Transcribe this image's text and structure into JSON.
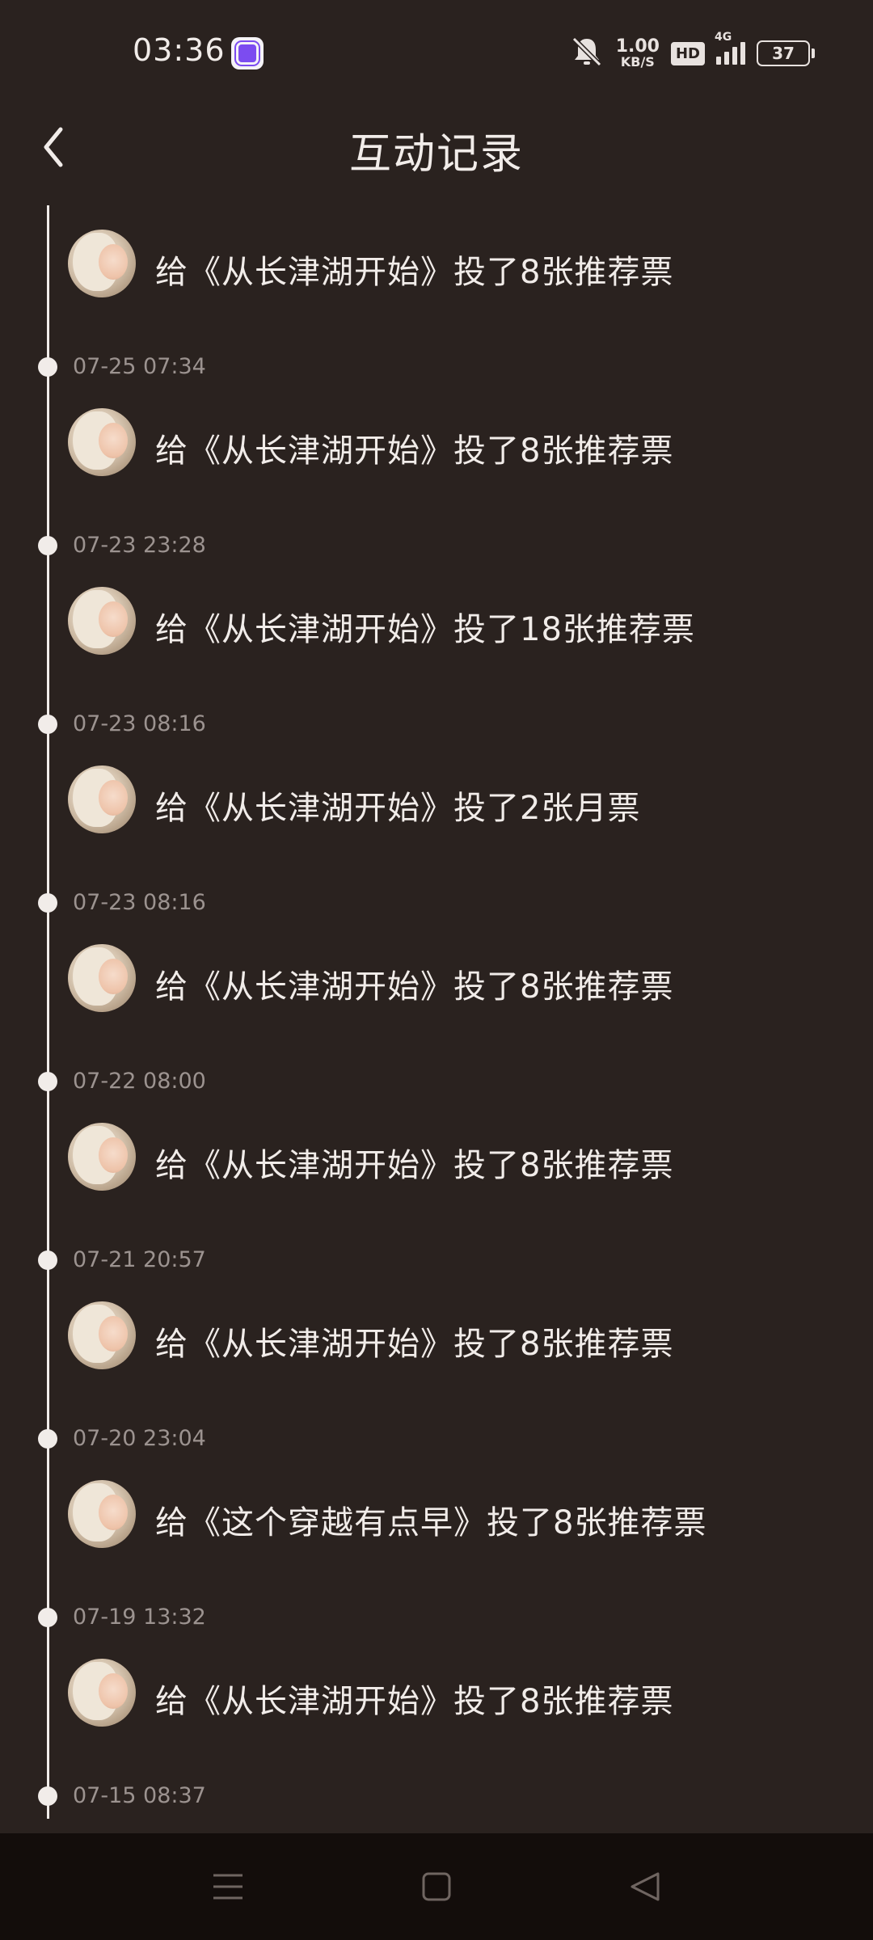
{
  "status_bar": {
    "time": "03:36",
    "net_speed_value": "1.00",
    "net_speed_unit": "KB/S",
    "hd_label": "HD",
    "network_label": "4G",
    "battery": "37",
    "icons": [
      "app-badge-icon",
      "mute-bell-icon",
      "signal-icon",
      "battery-icon"
    ]
  },
  "header": {
    "title": "互动记录",
    "back_icon": "chevron-left-icon"
  },
  "entries": [
    {
      "text": "给《从长津湖开始》投了8张推荐票",
      "date": "07-25 07:34"
    },
    {
      "text": "给《从长津湖开始》投了8张推荐票",
      "date": "07-23 23:28"
    },
    {
      "text": "给《从长津湖开始》投了18张推荐票",
      "date": "07-23 08:16"
    },
    {
      "text": "给《从长津湖开始》投了2张月票",
      "date": "07-23 08:16"
    },
    {
      "text": "给《从长津湖开始》投了8张推荐票",
      "date": "07-22 08:00"
    },
    {
      "text": "给《从长津湖开始》投了8张推荐票",
      "date": "07-21 20:57"
    },
    {
      "text": "给《从长津湖开始》投了8张推荐票",
      "date": "07-20 23:04"
    },
    {
      "text": "给《这个穿越有点早》投了8张推荐票",
      "date": "07-19 13:32"
    },
    {
      "text": "给《从长津湖开始》投了8张推荐票",
      "date": "07-15 08:37"
    }
  ],
  "nav_bar": {
    "icons": [
      "menu-icon",
      "home-icon",
      "back-triangle-icon"
    ]
  },
  "colors": {
    "background": "#2a221f",
    "text": "#f1ece9",
    "date_text": "#9c9390",
    "nav_background": "#130d0b"
  }
}
